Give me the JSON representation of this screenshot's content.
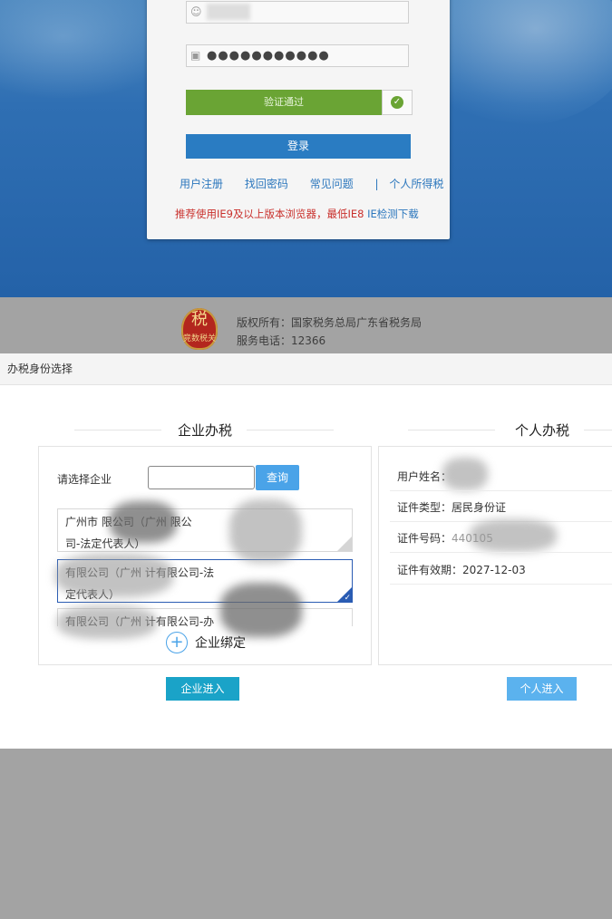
{
  "login": {
    "password_mask": "●●●●●●●●●●●",
    "verify_label": "验证通过",
    "login_button": "登录",
    "links": [
      "用户注册",
      "找回密码",
      "常见问题",
      "|",
      "个人所得税"
    ],
    "browser_tip": "推荐使用IE9及以上版本浏览器，最低IE8",
    "browser_check_link": "IE检测下载"
  },
  "footer": {
    "emblem_text": "税",
    "emblem_sub": "竞数税关",
    "copyright": "版权所有：国家税务总局广东省税务局",
    "phone": "服务电话：12366"
  },
  "modal": {
    "title": "办税身份选择",
    "enterprise": {
      "section_title": "企业办税",
      "select_label": "请选择企业",
      "search_value": "",
      "query_button": "查询",
      "companies": [
        {
          "line1": "广州市        限公司（广州         限公",
          "line2": "司-法定代表人）",
          "selected": false
        },
        {
          "line1": "         有限公司（广州       计有限公司-法",
          "line2": "定代表人）",
          "selected": true
        },
        {
          "line1": "         有限公司（广州       计有限公司-办",
          "line2": "",
          "selected": false
        }
      ],
      "bind_label": "企业绑定",
      "enter_button": "企业进入"
    },
    "personal": {
      "section_title": "个人办税",
      "name_label": "用户姓名：",
      "name_value": "",
      "id_type_label": "证件类型：",
      "id_type_value": "居民身份证",
      "id_number_label": "证件号码：",
      "id_number_value": "440105",
      "validity_label": "证件有效期：",
      "validity_value": "2027-12-03",
      "enter_button": "个人进入"
    }
  },
  "colors": {
    "accent_blue": "#2a7cc2",
    "verify_green": "#6aa434",
    "warning_red": "#c9302c",
    "enterprise_button": "#1aa3c8",
    "personal_button": "#5bb2ee"
  }
}
